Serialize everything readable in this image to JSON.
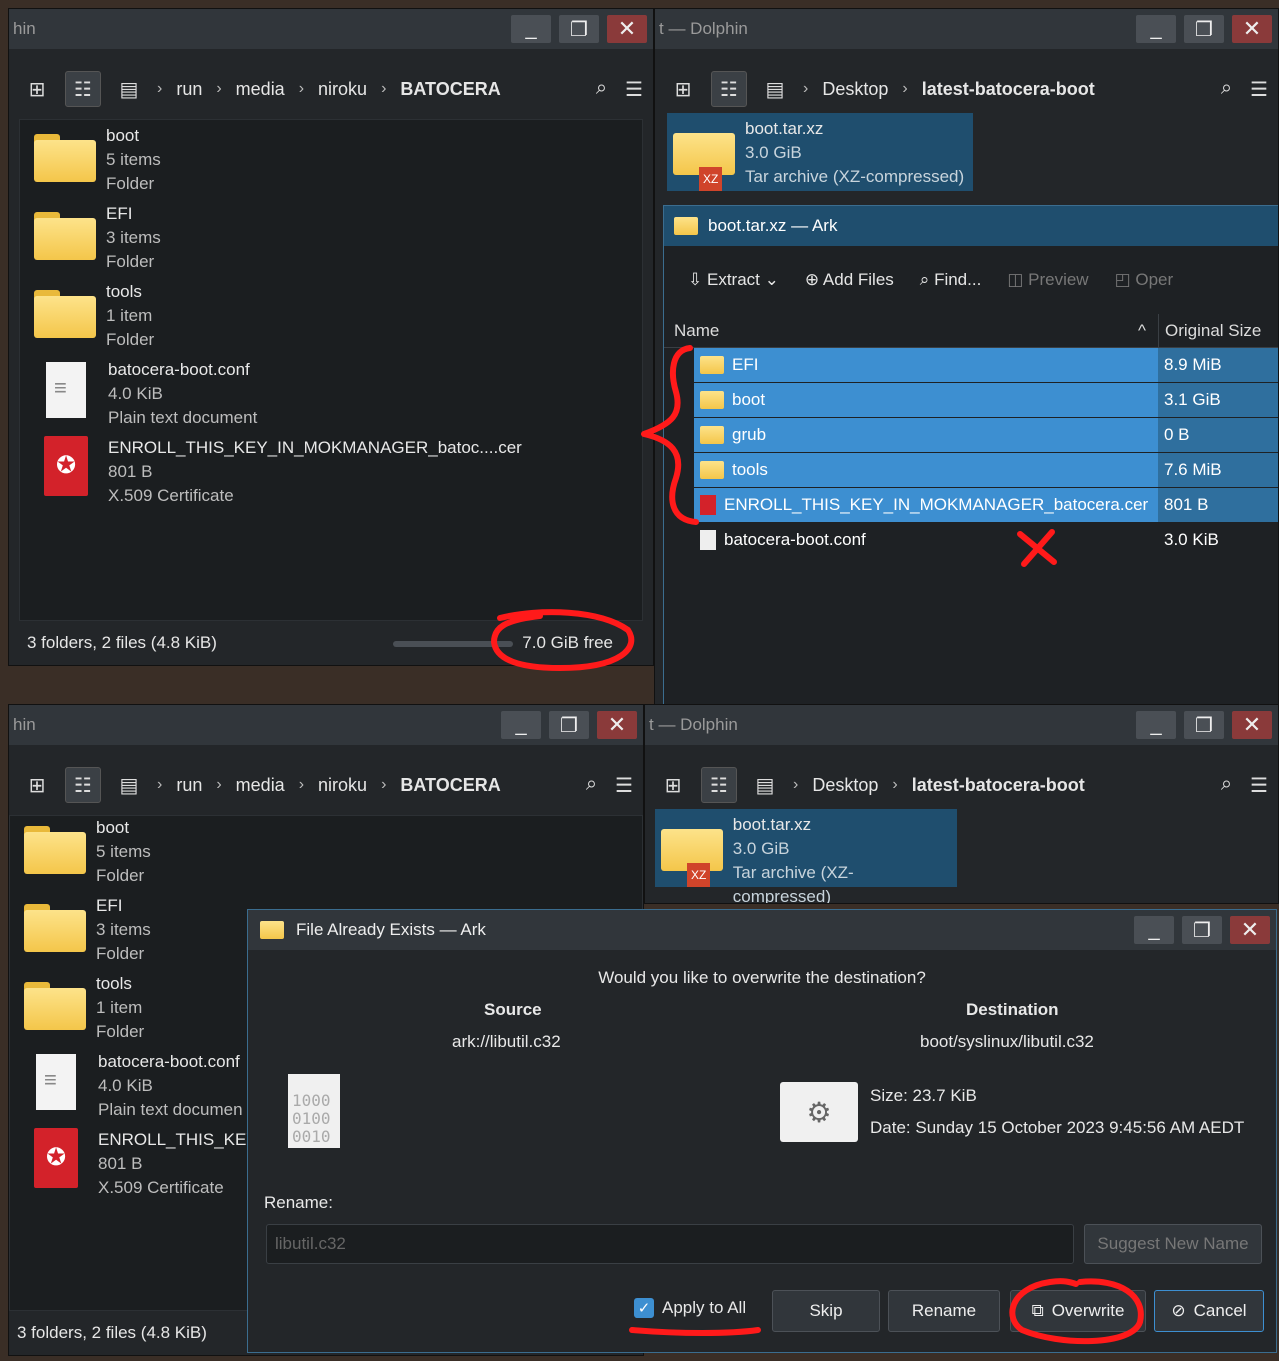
{
  "left_top": {
    "title": "hin",
    "crumbs": [
      "run",
      "media",
      "niroku",
      "BATOCERA"
    ],
    "files": [
      {
        "name": "boot",
        "line2": "5 items",
        "line3": "Folder",
        "icon": "folder-icon"
      },
      {
        "name": "EFI",
        "line2": "3 items",
        "line3": "Folder",
        "icon": "folder-icon"
      },
      {
        "name": "tools",
        "line2": "1 item",
        "line3": "Folder",
        "icon": "folder-icon"
      },
      {
        "name": "batocera-boot.conf",
        "line2": "4.0 KiB",
        "line3": "Plain text document",
        "icon": "text-file-icon"
      },
      {
        "name": "ENROLL_THIS_KEY_IN_MOKMANAGER_batoc....cer",
        "line2": "801 B",
        "line3": "X.509 Certificate",
        "icon": "certificate-icon"
      }
    ],
    "status": "3 folders, 2 files (4.8 KiB)",
    "free": "7.0 GiB free"
  },
  "right_top": {
    "title": "t — Dolphin",
    "crumbs": [
      "Desktop",
      "latest-batocera-boot"
    ],
    "archive": {
      "name": "boot.tar.xz",
      "size": "3.0 GiB",
      "type": "Tar archive (XZ-compressed)",
      "badge": "XZ"
    }
  },
  "ark": {
    "title": "boot.tar.xz — Ark",
    "toolbar": {
      "extract": "Extract",
      "add_files": "Add Files",
      "find": "Find...",
      "preview": "Preview",
      "open": "Oper"
    },
    "col_name": "Name",
    "col_size": "Original Size",
    "rows": [
      {
        "name": "EFI",
        "size": "8.9 MiB"
      },
      {
        "name": "boot",
        "size": "3.1 GiB"
      },
      {
        "name": "grub",
        "size": "0 B"
      },
      {
        "name": "tools",
        "size": "7.6 MiB"
      },
      {
        "name": "ENROLL_THIS_KEY_IN_MOKMANAGER_batocera.cer",
        "size": "801 B"
      },
      {
        "name": "batocera-boot.conf",
        "size": "3.0 KiB"
      }
    ]
  },
  "left_bottom": {
    "title": "hin",
    "crumbs": [
      "run",
      "media",
      "niroku",
      "BATOCERA"
    ],
    "files": [
      {
        "name": "boot",
        "line2": "5 items",
        "line3": "Folder"
      },
      {
        "name": "EFI",
        "line2": "3 items",
        "line3": "Folder"
      },
      {
        "name": "tools",
        "line2": "1 item",
        "line3": "Folder"
      },
      {
        "name": "batocera-boot.conf",
        "line2": "4.0 KiB",
        "line3": "Plain text documen"
      },
      {
        "name": "ENROLL_THIS_KEY_",
        "line2": "801 B",
        "line3": "X.509 Certificate"
      }
    ],
    "status": "3 folders, 2 files (4.8 KiB)"
  },
  "right_bottom": {
    "title": "t — Dolphin",
    "crumbs": [
      "Desktop",
      "latest-batocera-boot"
    ],
    "archive": {
      "name": "boot.tar.xz",
      "size": "3.0 GiB",
      "type": "Tar archive (XZ-compressed)",
      "badge": "XZ"
    }
  },
  "dialog": {
    "title": "File Already Exists — Ark",
    "question": "Would you like to overwrite the destination?",
    "source_label": "Source",
    "dest_label": "Destination",
    "source_path": "ark://libutil.c32",
    "dest_path": "boot/syslinux/libutil.c32",
    "size": "Size: 23.7 KiB",
    "date": "Date: Sunday 15 October 2023 9:45:56 AM AEDT",
    "bin_text": [
      "1000",
      "0100",
      "0010"
    ],
    "rename_label": "Rename:",
    "rename_placeholder": "libutil.c32",
    "suggest": "Suggest New Name",
    "apply_all": "Apply to All",
    "skip": "Skip",
    "rename_btn": "Rename",
    "overwrite": "Overwrite",
    "cancel": "Cancel"
  },
  "colors": {
    "annotation": "#ff1a1a",
    "selection": "#3d8fd1",
    "folder": "#f4c64a"
  }
}
